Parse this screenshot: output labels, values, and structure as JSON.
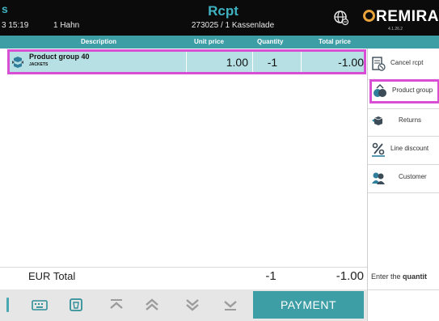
{
  "header": {
    "app_letter": "s",
    "time": "3  15:19",
    "user": "1 Hahn",
    "title": "Rcpt",
    "subtitle": "273025 / 1 Kassenlade",
    "logo": "REMIRA",
    "version": "4.1.26.2"
  },
  "columns": {
    "description": "Description",
    "unit_price": "Unit price",
    "quantity": "Quantity",
    "total_price": "Total price"
  },
  "line_items": [
    {
      "name": "Product group 40",
      "category": "JACKETS",
      "unit_price": "1.00",
      "quantity": "-1",
      "total": "-1.00"
    }
  ],
  "totals": {
    "label": "EUR Total",
    "quantity": "-1",
    "total": "-1.00"
  },
  "toolbar": {
    "payment_label": "PAYMENT",
    "icons": [
      "keyboard-icon",
      "delete-icon",
      "first-line-icon",
      "page-up-icon",
      "page-down-icon",
      "last-line-icon"
    ]
  },
  "side_panel": {
    "items": [
      {
        "label": "Cancel rcpt",
        "icon": "cancel-receipt-icon"
      },
      {
        "label": "Product group",
        "icon": "product-group-icon"
      },
      {
        "label": "Returns",
        "icon": "returns-icon"
      },
      {
        "label": "Line discount",
        "icon": "percent-icon"
      },
      {
        "label": "Customer",
        "icon": "customer-icon"
      }
    ],
    "hint_prefix": "Enter the ",
    "hint_bold": "quantit"
  },
  "colors": {
    "accent": "#3e9ea6",
    "selected_row": "#b6e0e4",
    "highlight": "#d84fd6",
    "header_bg": "#0b0b0b",
    "logo_ring": "#e8a33a"
  }
}
